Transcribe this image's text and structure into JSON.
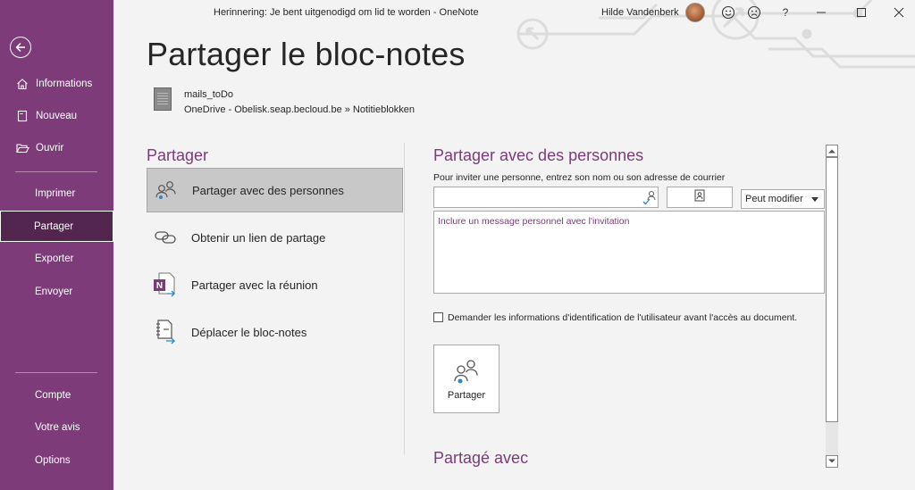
{
  "window": {
    "title": "Herinnering: Je bent uitgenodigd om lid te worden  -  OneNote",
    "user_name": "Hilde Vandenberk",
    "help_label": "?"
  },
  "sidebar": {
    "items": [
      {
        "label": "Informations",
        "icon": "home-icon"
      },
      {
        "label": "Nouveau",
        "icon": "new-page-icon"
      },
      {
        "label": "Ouvrir",
        "icon": "folder-open-icon"
      },
      {
        "label": "Imprimer"
      },
      {
        "label": "Partager"
      },
      {
        "label": "Exporter"
      },
      {
        "label": "Envoyer"
      },
      {
        "label": "Compte"
      },
      {
        "label": "Votre avis"
      },
      {
        "label": "Options"
      }
    ],
    "active": "Partager"
  },
  "main": {
    "title": "Partager le bloc-notes",
    "notebook": {
      "name": "mails_toDo",
      "path": "OneDrive - Obelisk.seap.becloud.be » Notitieblokken"
    },
    "share_section": {
      "heading": "Partager",
      "options": [
        {
          "label": "Partager avec des personnes",
          "icon": "people-share-icon"
        },
        {
          "label": "Obtenir un lien de partage",
          "icon": "link-icon"
        },
        {
          "label": "Partager avec la réunion",
          "icon": "onenote-meeting-icon"
        },
        {
          "label": "Déplacer le bloc-notes",
          "icon": "move-notebook-icon"
        }
      ]
    },
    "people_panel": {
      "heading": "Partager avec des personnes",
      "invite_label": "Pour inviter une personne, entrez son nom ou son adresse de courrier",
      "invite_value": "",
      "permission": "Peut modifier",
      "message_placeholder": "Inclure un message personnel avec l'invitation",
      "require_signin_label": "Demander les informations d'identification de l'utilisateur avant l'accès au document.",
      "require_signin_checked": false,
      "share_button_label": "Partager",
      "shared_with_heading": "Partagé avec"
    }
  },
  "colors": {
    "sidebar": "#7d3b7a",
    "sidebar_active": "#53264f",
    "accent_text": "#7d3b7a"
  }
}
